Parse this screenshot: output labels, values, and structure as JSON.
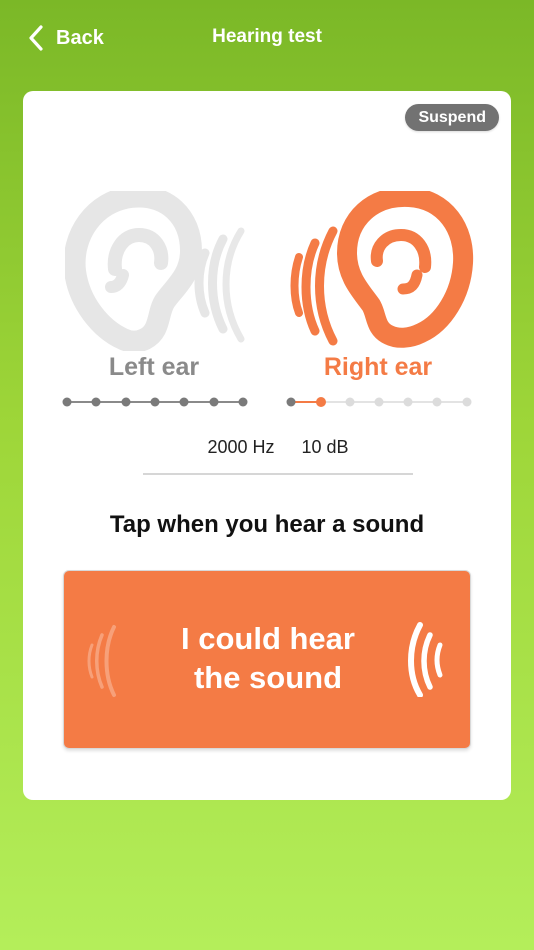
{
  "header": {
    "back_label": "Back",
    "title": "Hearing test"
  },
  "card": {
    "suspend_label": "Suspend",
    "ears": {
      "left": {
        "label": "Left ear",
        "steps_total": 7,
        "steps_done": 7
      },
      "right": {
        "label": "Right ear",
        "steps_total": 7,
        "steps_done": 1
      }
    },
    "readout": {
      "frequency": "2000 Hz",
      "level": "10 dB"
    },
    "instruction": "Tap when you hear a sound",
    "hear_button": {
      "line1": "I could hear",
      "line2": "the sound"
    }
  },
  "colors": {
    "accent": "#f47b45",
    "inactive": "#e6e6e6",
    "header_green": "#7bb827",
    "suspend_bg": "#727272"
  },
  "icons": {
    "back": "chevron-left-icon",
    "left_ear": "ear-left-icon",
    "right_ear": "ear-right-icon",
    "sound_waves": "sound-waves-icon"
  }
}
